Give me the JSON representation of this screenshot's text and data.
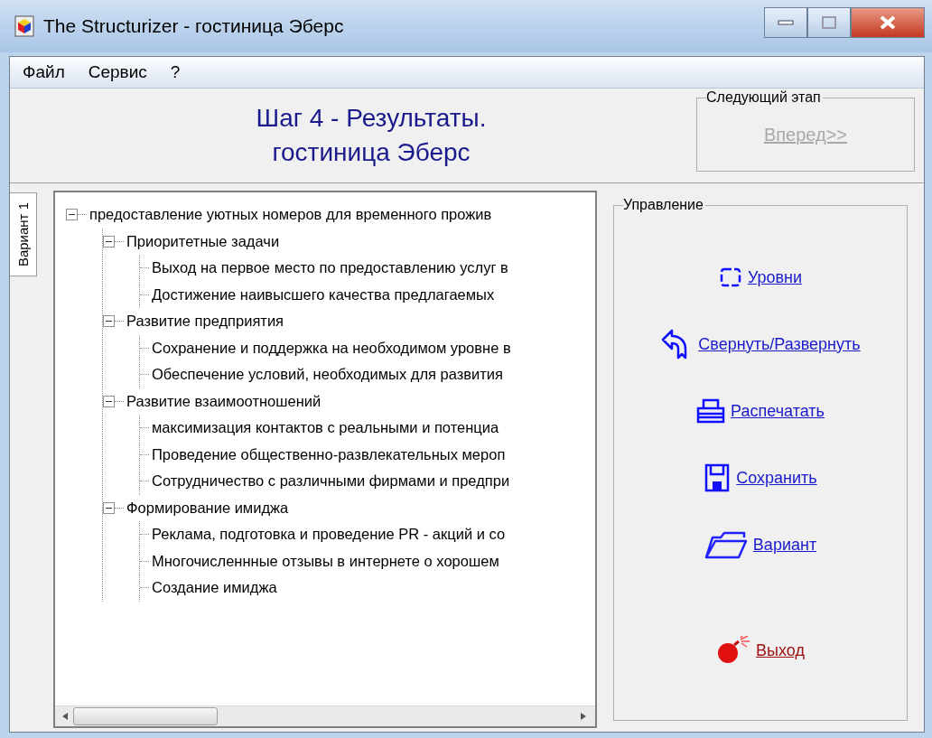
{
  "window": {
    "title": "The Structurizer - гостиница Эберс"
  },
  "menu": [
    "Файл",
    "Сервис",
    "?"
  ],
  "header": {
    "title_lines": [
      "Шаг 4 - Результаты.",
      "гостиница Эберс"
    ]
  },
  "next_stage": {
    "label": "Следующий этап",
    "button": {
      "label": "Вперед>>",
      "disabled": true
    }
  },
  "tabs": [
    {
      "label": "Вариант 1",
      "selected": true
    }
  ],
  "tree": [
    {
      "label": "предоставление уютных номеров для временного прожив",
      "expanded": true,
      "children": [
        {
          "label": "Приоритетные задачи",
          "expanded": true,
          "children": [
            {
              "label": "Выход на первое место по предоставлению услуг в"
            },
            {
              "label": "Достижение наивысшего качества предлагаемых"
            }
          ]
        },
        {
          "label": "Развитие предприятия",
          "expanded": true,
          "children": [
            {
              "label": "Сохранение и поддержка на необходимом уровне в"
            },
            {
              "label": "Обеспечение условий, необходимых для развития"
            }
          ]
        },
        {
          "label": "Развитие взаимоотношений",
          "expanded": true,
          "children": [
            {
              "label": "максимизация контактов с реальными и потенциа"
            },
            {
              "label": "Проведение общественно-развлекательных мероп"
            },
            {
              "label": "Сотрудничество с различными фирмами и предпри"
            }
          ]
        },
        {
          "label": "Формирование имиджа",
          "expanded": true,
          "children": [
            {
              "label": "Реклама, подготовка и проведение PR - акций и со"
            },
            {
              "label": "Многочисленнные отзывы в интернете о хорошем"
            },
            {
              "label": "Создание имиджа"
            }
          ]
        }
      ]
    }
  ],
  "controls": {
    "label": "Управление",
    "actions": [
      {
        "kind": "levels",
        "label": "Уровни"
      },
      {
        "kind": "collapse",
        "label": "Свернуть/Развернуть"
      },
      {
        "kind": "print",
        "label": "Распечатать"
      },
      {
        "kind": "save",
        "label": "Сохранить"
      },
      {
        "kind": "variant",
        "label": "Вариант"
      },
      {
        "kind": "exit",
        "label": "Выход"
      }
    ]
  }
}
